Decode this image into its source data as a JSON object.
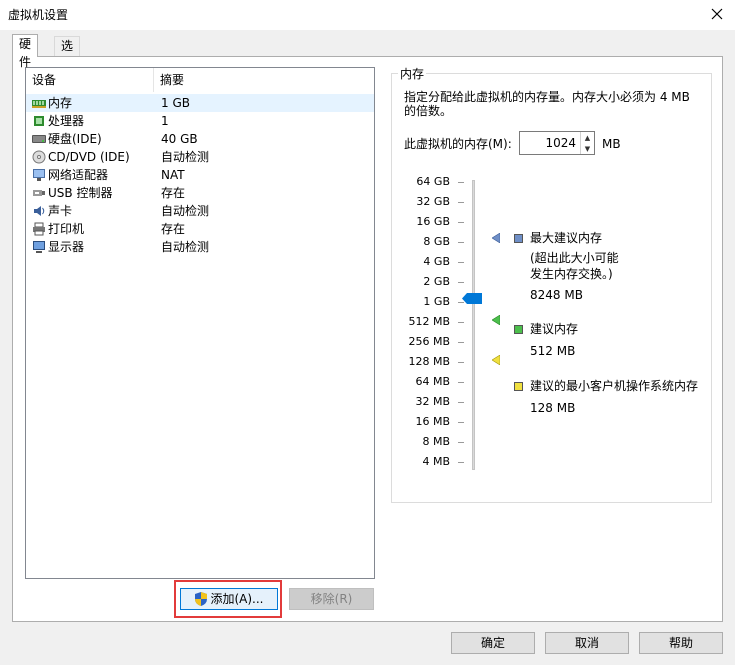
{
  "window": {
    "title": "虚拟机设置"
  },
  "tabs": [
    {
      "label": "硬件",
      "active": true
    },
    {
      "label": "选项",
      "active": false
    }
  ],
  "device_table": {
    "headers": [
      "设备",
      "摘要"
    ],
    "rows": [
      {
        "name": "内存",
        "summary": "1 GB",
        "icon": "memory-icon",
        "selected": true
      },
      {
        "name": "处理器",
        "summary": "1",
        "icon": "processor-icon"
      },
      {
        "name": "硬盘(IDE)",
        "summary": "40 GB",
        "icon": "hard-disk-icon"
      },
      {
        "name": "CD/DVD (IDE)",
        "summary": "自动检测",
        "icon": "cd-dvd-icon"
      },
      {
        "name": "网络适配器",
        "summary": "NAT",
        "icon": "network-adapter-icon"
      },
      {
        "name": "USB 控制器",
        "summary": "存在",
        "icon": "usb-icon"
      },
      {
        "name": "声卡",
        "summary": "自动检测",
        "icon": "sound-card-icon"
      },
      {
        "name": "打印机",
        "summary": "存在",
        "icon": "printer-icon"
      },
      {
        "name": "显示器",
        "summary": "自动检测",
        "icon": "display-icon"
      }
    ]
  },
  "buttons": {
    "add": "添加(A)...",
    "remove": "移除(R)",
    "ok": "确定",
    "cancel": "取消",
    "help": "帮助"
  },
  "memory_panel": {
    "group_title": "内存",
    "description": "指定分配给此虚拟机的内存量。内存大小必须为 4 MB 的倍数。",
    "memory_label": "此虚拟机的内存(M):",
    "memory_value": "1024",
    "memory_unit": "MB",
    "scale_ticks": [
      "64 GB",
      "32 GB",
      "16 GB",
      "8 GB",
      "4 GB",
      "2 GB",
      "1 GB",
      "512 MB",
      "256 MB",
      "128 MB",
      "64 MB",
      "32 MB",
      "16 MB",
      "8 MB",
      "4 MB"
    ],
    "legend": {
      "max_title": "最大建议内存",
      "max_note_line1": "(超出此大小可能",
      "max_note_line2": "发生内存交换。)",
      "max_value": "8248 MB",
      "rec_title": "建议内存",
      "rec_value": "512 MB",
      "min_title": "建议的最小客户机操作系统内存",
      "min_value": "128 MB"
    },
    "colors": {
      "max": "#6f8fc7",
      "recommended": "#4cbf4c",
      "minimum": "#f0e040",
      "thumb": "#0078d7"
    }
  }
}
